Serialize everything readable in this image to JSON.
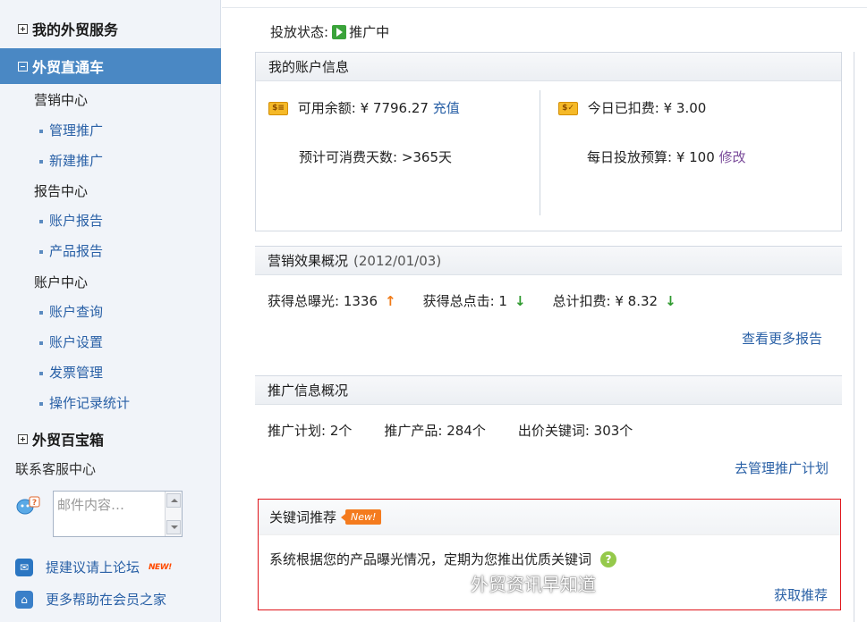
{
  "sidebar": {
    "sections": {
      "my_services": "我的外贸服务",
      "direct_train": "外贸直通车",
      "treasure_box": "外贸百宝箱"
    },
    "groups": {
      "marketing": "营销中心",
      "report": "报告中心",
      "account": "账户中心"
    },
    "items": {
      "manage": "管理推广",
      "create": "新建推广",
      "account_report": "账户报告",
      "product_report": "产品报告",
      "account_query": "账户查询",
      "account_settings": "账户设置",
      "invoice": "发票管理",
      "operation_log": "操作记录统计"
    },
    "contact": "联系客服中心",
    "mail_placeholder": "邮件内容…",
    "forum_link": "提建议请上论坛",
    "forum_new": "NEW!",
    "help_link": "更多帮助在会员之家"
  },
  "main": {
    "status_label": "投放状态:",
    "status_value": "推广中",
    "account": {
      "title": "我的账户信息",
      "balance_label": "可用余额: ¥ 7796.27",
      "recharge": "充值",
      "days_label": "预计可消费天数: >365天",
      "today_label": "今日已扣费: ¥ 3.00",
      "budget_label": "每日投放预算: ¥ 100",
      "modify": "修改"
    },
    "effect": {
      "title": "营销效果概况",
      "date": "(2012/01/03)",
      "exposure": "获得总曝光: 1336",
      "clicks": "获得总点击: 1",
      "cost": "总计扣费: ¥ 8.32",
      "more": "查看更多报告"
    },
    "promo": {
      "title": "推广信息概况",
      "plans": "推广计划: 2个",
      "products": "推广产品: 284个",
      "keywords": "出价关键词: 303个",
      "manage": "去管理推广计划"
    },
    "keyword": {
      "title": "关键词推荐",
      "badge": "New!",
      "desc": "系统根据您的产品曝光情况，定期为您推出优质关键词",
      "get": "获取推荐"
    }
  },
  "watermark": "外贸资讯早知道",
  "colors": {
    "sidebar_active": "#4a88c4",
    "link": "#2960a6",
    "highlight_border": "#e0141a",
    "badge": "#f47b1e"
  }
}
